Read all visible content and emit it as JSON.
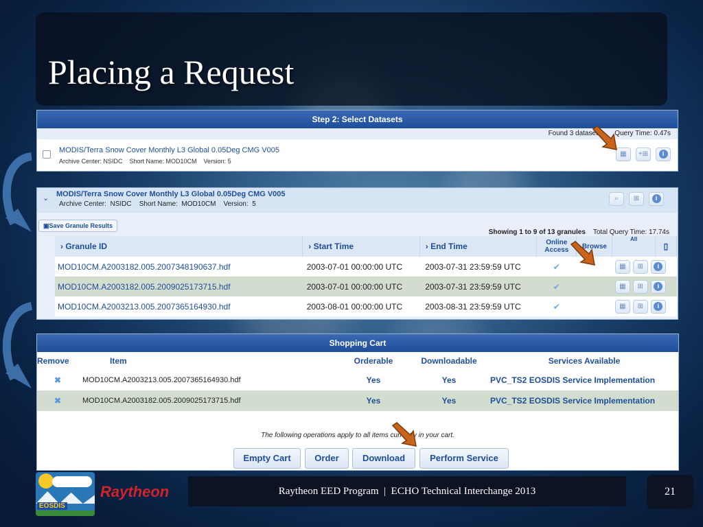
{
  "slide": {
    "title": "Placing a Request",
    "footer": "Raytheon EED Program  |  ECHO Technical Interchange 2013",
    "page_number": "21",
    "raytheon_logo": "Raytheon",
    "eosdis_logo": "EOSDIS"
  },
  "datasets": {
    "header": "Step 2: Select Datasets",
    "found": "Found 3 datasets",
    "query_time": "Query Time: 0.47s",
    "item_title": "MODIS/Terra Snow Cover Monthly L3 Global 0.05Deg CMG V005",
    "item_meta": "Archive Center: NSIDC    Short Name: MOD10CM    Version: 5",
    "add_label": "+"
  },
  "granules": {
    "dataset_title": "MODIS/Terra Snow Cover Monthly L3 Global 0.05Deg CMG V005",
    "dataset_meta": "Archive Center:  NSIDC    Short Name:  MOD10CM    Version:  5",
    "save_label": "Save Granule Results",
    "showing": "Showing 1 to 9 of 13 granules",
    "total_time": "Total Query Time: 17.74s",
    "columns": {
      "id": "Granule ID",
      "start": "Start Time",
      "end": "End Time",
      "online": "Online Access",
      "browse": "Browse",
      "all": "All"
    },
    "rows": [
      {
        "id": "MOD10CM.A2003182.005.2007348190637.hdf",
        "start": "2003-07-01 00:00:00 UTC",
        "end": "2003-07-31 23:59:59 UTC"
      },
      {
        "id": "MOD10CM.A2003182.005.2009025173715.hdf",
        "start": "2003-07-01 00:00:00 UTC",
        "end": "2003-07-31 23:59:59 UTC"
      },
      {
        "id": "MOD10CM.A2003213.005.2007365164930.hdf",
        "start": "2003-08-01 00:00:00 UTC",
        "end": "2003-08-31 23:59:59 UTC"
      }
    ]
  },
  "cart": {
    "header": "Shopping Cart",
    "columns": {
      "remove": "Remove",
      "item": "Item",
      "orderable": "Orderable",
      "downloadable": "Downloadable",
      "services": "Services Available"
    },
    "rows": [
      {
        "item": "MOD10CM.A2003213.005.2007365164930.hdf",
        "orderable": "Yes",
        "downloadable": "Yes",
        "service": "PVC_TS2 EOSDIS Service Implementation"
      },
      {
        "item": "MOD10CM.A2003182.005.2009025173715.hdf",
        "orderable": "Yes",
        "downloadable": "Yes",
        "service": "PVC_TS2 EOSDIS Service Implementation"
      }
    ],
    "note": "The following operations apply to all items currently in your cart.",
    "buttons": {
      "empty": "Empty Cart",
      "order": "Order",
      "download": "Download",
      "perform": "Perform Service"
    }
  },
  "colors": {
    "accent": "#1e4e9a",
    "arrow": "#c8641e",
    "raytheon_red": "#d2232a"
  }
}
